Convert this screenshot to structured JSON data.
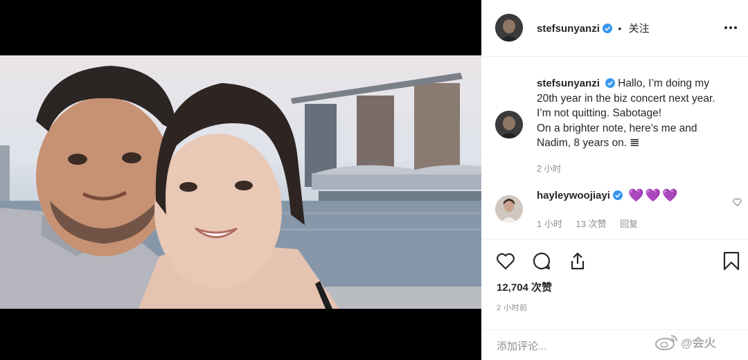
{
  "post": {
    "username": "stefsunyanzi",
    "dot": "•",
    "follow_label": "关注"
  },
  "caption": {
    "username": "stefsunyanzi",
    "line1": "Hallo, I’m doing my",
    "line2": "20th year in the biz concert next year.",
    "line3": "I’m not quitting. Sabotage!",
    "line4": "On a brighter note, here’s me and",
    "line5": "Nadim, 8 years on. 𝌆",
    "time": "2 小时"
  },
  "comment": {
    "username": "hayleywoojiayi",
    "text": "💜💜💜",
    "time": "1 小时",
    "likes": "13 次赞",
    "reply": "回复"
  },
  "stats": {
    "likes": "12,704 次赞",
    "posted": "2 小时前"
  },
  "input": {
    "placeholder": "添加评论..."
  },
  "watermark": {
    "text": "@会火"
  },
  "icons": {
    "verified": "verified-badge-icon",
    "more": "more-options-icon",
    "like": "heart-icon",
    "comment": "comment-icon",
    "share": "share-icon",
    "save": "bookmark-icon"
  },
  "colors": {
    "verified": "#3897f0",
    "text": "#262626",
    "muted": "#8e8e8e",
    "hearts": "#9b59d0"
  }
}
